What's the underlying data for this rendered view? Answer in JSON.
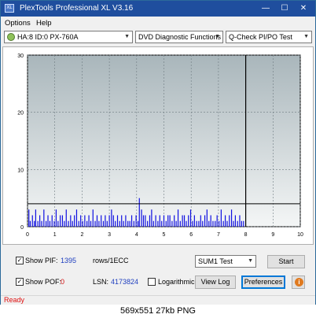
{
  "window": {
    "title": "PlexTools Professional XL V3.16",
    "icon_text": "XL"
  },
  "menu": [
    "Options",
    "Help"
  ],
  "toolbar": {
    "drive": "HA:8 ID:0  PX-760A",
    "function": "DVD Diagnostic Functions",
    "test": "Q-Check PI/PO Test"
  },
  "chart_data": {
    "type": "bar",
    "y_ticks": [
      "30",
      "20",
      "10",
      "0"
    ],
    "x_ticks": [
      "0",
      "1",
      "2",
      "3",
      "4",
      "5",
      "6",
      "7",
      "8",
      "9",
      "10"
    ],
    "xlim": [
      0,
      10
    ],
    "ylim": [
      0,
      30
    ],
    "threshold_line": 4,
    "end_marker": 8,
    "grid": true,
    "series": [
      {
        "color": "#1010e0",
        "x": [
          0.05,
          0.1,
          0.18,
          0.25,
          0.3,
          0.38,
          0.45,
          0.52,
          0.6,
          0.68,
          0.75,
          0.82,
          0.9,
          0.98,
          1.05,
          1.12,
          1.2,
          1.28,
          1.35,
          1.42,
          1.5,
          1.58,
          1.65,
          1.72,
          1.8,
          1.88,
          1.95,
          2.02,
          2.1,
          2.18,
          2.25,
          2.32,
          2.4,
          2.48,
          2.55,
          2.62,
          2.7,
          2.78,
          2.85,
          2.92,
          3.0,
          3.08,
          3.15,
          3.22,
          3.3,
          3.38,
          3.45,
          3.52,
          3.6,
          3.68,
          3.75,
          3.82,
          3.9,
          3.98,
          4.05,
          4.1,
          4.18,
          4.25,
          4.32,
          4.4,
          4.48,
          4.55,
          4.62,
          4.7,
          4.78,
          4.85,
          4.92,
          5.0,
          5.08,
          5.15,
          5.22,
          5.3,
          5.38,
          5.45,
          5.52,
          5.6,
          5.68,
          5.75,
          5.82,
          5.9,
          5.98,
          6.05,
          6.12,
          6.2,
          6.28,
          6.35,
          6.42,
          6.5,
          6.58,
          6.65,
          6.72,
          6.8,
          6.88,
          6.95,
          7.02,
          7.1,
          7.18,
          7.25,
          7.32,
          7.4,
          7.48,
          7.55,
          7.62,
          7.7,
          7.78,
          7.85,
          7.92
        ],
        "values": [
          3,
          1,
          2,
          1,
          3,
          1,
          2,
          1,
          3,
          1,
          2,
          1,
          2,
          1,
          3,
          1,
          2,
          2,
          1,
          3,
          1,
          2,
          1,
          2,
          3,
          1,
          2,
          1,
          2,
          1,
          2,
          1,
          3,
          1,
          2,
          1,
          2,
          1,
          2,
          1,
          2,
          3,
          2,
          1,
          2,
          1,
          2,
          1,
          2,
          1,
          1,
          2,
          1,
          2,
          1,
          5,
          3,
          2,
          2,
          1,
          2,
          3,
          1,
          2,
          1,
          2,
          1,
          2,
          1,
          2,
          2,
          1,
          2,
          1,
          3,
          1,
          2,
          2,
          1,
          2,
          3,
          1,
          2,
          1,
          1,
          2,
          1,
          2,
          3,
          1,
          2,
          1,
          1,
          2,
          1,
          3,
          1,
          2,
          1,
          2,
          3,
          1,
          2,
          1,
          2,
          1,
          1
        ]
      }
    ]
  },
  "controls": {
    "show_pif_label": "Show PIF:",
    "pif_value": "1395",
    "pif_unit": "rows/1ECC",
    "show_pof_label": "Show POF:",
    "pof_value": "0",
    "lsn_label": "LSN:",
    "lsn_value": "4173824",
    "logarithmic_label": "Logarithmic",
    "sum_select": "SUM1 Test",
    "start_label": "Start",
    "view_log_label": "View Log",
    "preferences_label": "Preferences",
    "pif_checked": "✓",
    "pof_checked": "✓"
  },
  "status": "Ready",
  "caption": "569x551 27kb PNG"
}
